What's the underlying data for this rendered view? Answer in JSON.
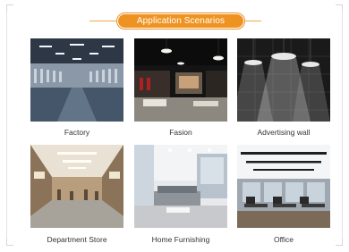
{
  "header": {
    "title": "Application Scenarios"
  },
  "scenarios": [
    {
      "label": "Factory",
      "image": "factory-photo"
    },
    {
      "label": "Fasion",
      "image": "fashion-store-photo"
    },
    {
      "label": "Advertising wall",
      "image": "advertising-wall-photo"
    },
    {
      "label": "Department Store",
      "image": "department-store-photo"
    },
    {
      "label": "Home Furnishing",
      "image": "home-furnishing-photo"
    },
    {
      "label": "Office",
      "image": "office-photo"
    }
  ],
  "colors": {
    "accent": "#ee9322",
    "accent_border": "#e98f24",
    "caption_text": "#333333",
    "frame": "#d6d6d6"
  }
}
